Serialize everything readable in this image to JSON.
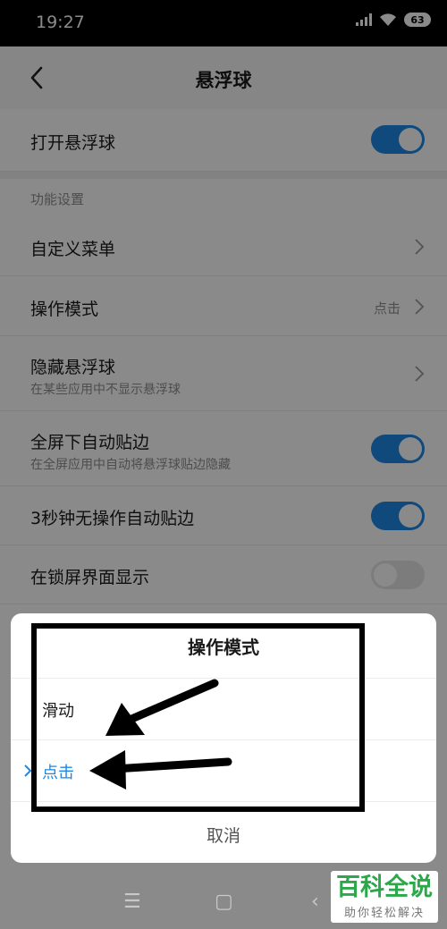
{
  "status_bar": {
    "time": "19:27",
    "battery": "63"
  },
  "header": {
    "title": "悬浮球"
  },
  "settings": {
    "main_toggle_label": "打开悬浮球",
    "section_title": "功能设置",
    "custom_menu": "自定义菜单",
    "operation_mode": "操作模式",
    "operation_mode_value": "点击",
    "hide_ball": "隐藏悬浮球",
    "hide_ball_sub": "在某些应用中不显示悬浮球",
    "fullscreen_snap": "全屏下自动贴边",
    "fullscreen_snap_sub": "在全屏应用中自动将悬浮球贴边隐藏",
    "idle_snap": "3秒钟无操作自动贴边",
    "lockscreen_show": "在锁屏界面显示"
  },
  "toggles": {
    "main": true,
    "fullscreen_snap": true,
    "idle_snap": true,
    "lockscreen_show": false
  },
  "dialog": {
    "title": "操作模式",
    "options": [
      {
        "label": "滑动",
        "selected": false
      },
      {
        "label": "点击",
        "selected": true
      }
    ],
    "cancel": "取消"
  },
  "nav": {
    "menu": "☰",
    "home": "▢",
    "back": "‹"
  },
  "watermark": {
    "main": "百科全说",
    "sub": "助你轻松解决"
  },
  "colors": {
    "accent": "#1e88e5",
    "watermark_green": "#2ca84b",
    "annotation": "#000000"
  },
  "icons": [
    "back-arrow-icon",
    "chevron-right-icon",
    "checkmark-icon",
    "signal-icon",
    "wifi-icon",
    "battery-icon"
  ]
}
